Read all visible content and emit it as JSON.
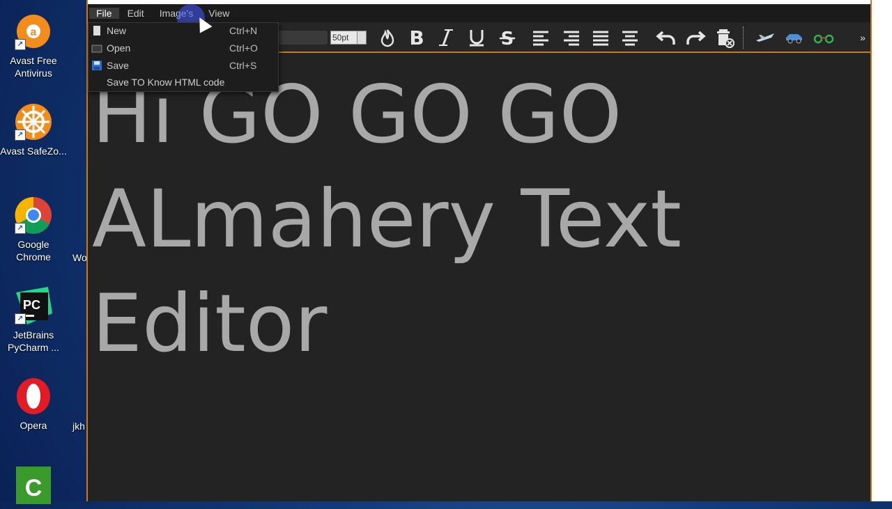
{
  "desktop": {
    "icons": [
      {
        "label": "Avast Free Antivirus",
        "icon": "avast-icon",
        "color": "#f28c1b"
      },
      {
        "label": "Avast SafeZo...",
        "icon": "safezone-icon",
        "color": "#f28c1b"
      },
      {
        "label": "Google Chrome",
        "icon": "chrome-icon",
        "color": "#4285f4"
      },
      {
        "label": "JetBrains PyCharm ...",
        "icon": "pycharm-icon",
        "color": "#21d789"
      },
      {
        "label": "Opera",
        "icon": "opera-icon",
        "color": "#e21c24"
      },
      {
        "label": "",
        "icon": "camtasia-icon",
        "color": "#3a9a2b"
      }
    ],
    "peek_labels": [
      "Wo",
      "jkh"
    ]
  },
  "app": {
    "menu": [
      "File",
      "Edit",
      "Image's",
      "View"
    ],
    "active_menu": "File",
    "file_menu": [
      {
        "label": "New",
        "shortcut": "Ctrl+N",
        "icon": "new-file-icon"
      },
      {
        "label": "Open",
        "shortcut": "Ctrl+O",
        "icon": "open-folder-icon"
      },
      {
        "label": "Save",
        "shortcut": "Ctrl+S",
        "icon": "save-icon"
      },
      {
        "label": "Save TO Know HTML code",
        "shortcut": "",
        "icon": ""
      }
    ],
    "toolbar": {
      "font_size": "50pt",
      "overflow": "»"
    },
    "document_lines": [
      "Hi GO GO GO",
      "ALmahery Text",
      "Editor"
    ],
    "accent_color": "#c97a1a"
  }
}
